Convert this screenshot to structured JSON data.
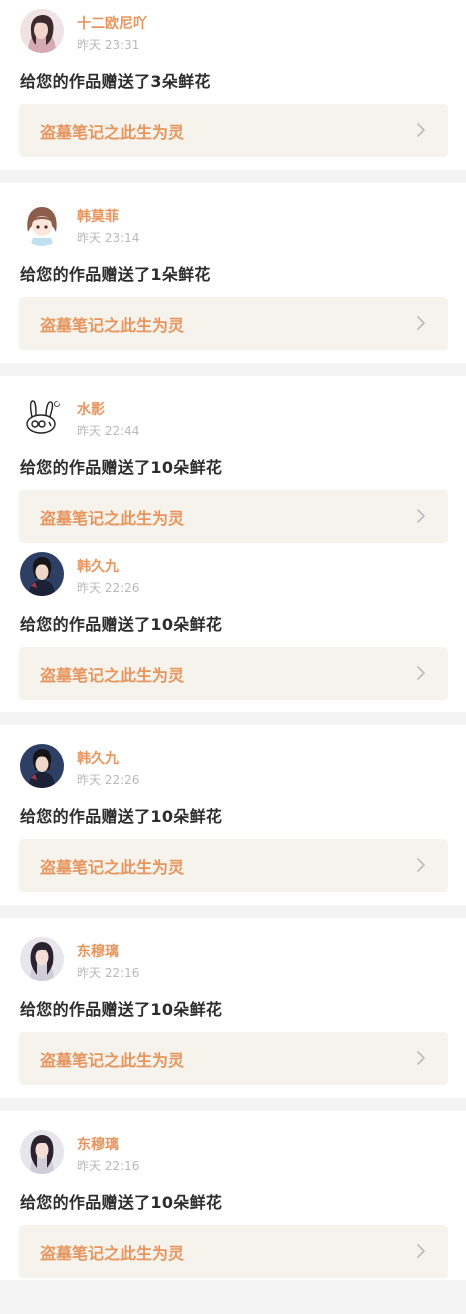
{
  "notifications": [
    {
      "user": "十二欧尼吖",
      "time": "昨天 23:31",
      "message": "给您的作品赠送了3朵鲜花",
      "work": "盗墓笔记之此生为灵",
      "avatar": "girl-photo-avatar"
    },
    {
      "user": "韩莫菲",
      "time": "昨天 23:14",
      "message": "给您的作品赠送了1朵鲜花",
      "work": "盗墓笔记之此生为灵",
      "avatar": "cartoon-girl-avatar"
    },
    {
      "user": "水影",
      "time": "昨天 22:44",
      "message": "给您的作品赠送了10朵鲜花",
      "work": "盗墓笔记之此生为灵",
      "avatar": "sketch-bunny-avatar"
    },
    {
      "user": "韩久九",
      "time": "昨天 22:26",
      "message": "给您的作品赠送了10朵鲜花",
      "work": "盗墓笔记之此生为灵",
      "avatar": "costume-man-avatar"
    },
    {
      "user": "韩久九",
      "time": "昨天 22:26",
      "message": "给您的作品赠送了10朵鲜花",
      "work": "盗墓笔记之此生为灵",
      "avatar": "costume-man-avatar"
    },
    {
      "user": "东穆璃",
      "time": "昨天 22:16",
      "message": "给您的作品赠送了10朵鲜花",
      "work": "盗墓笔记之此生为灵",
      "avatar": "woman-photo-avatar"
    },
    {
      "user": "东穆璃",
      "time": "昨天 22:16",
      "message": "给您的作品赠送了10朵鲜花",
      "work": "盗墓笔记之此生为灵",
      "avatar": "woman-photo-avatar"
    }
  ],
  "colors": {
    "accent": "#e7955f",
    "message_text": "#2d2d2d",
    "timestamp": "#b9b9b9",
    "link_background": "#f5f3eb",
    "page_background": "#f4f4f4",
    "card_background": "#ffffff"
  }
}
